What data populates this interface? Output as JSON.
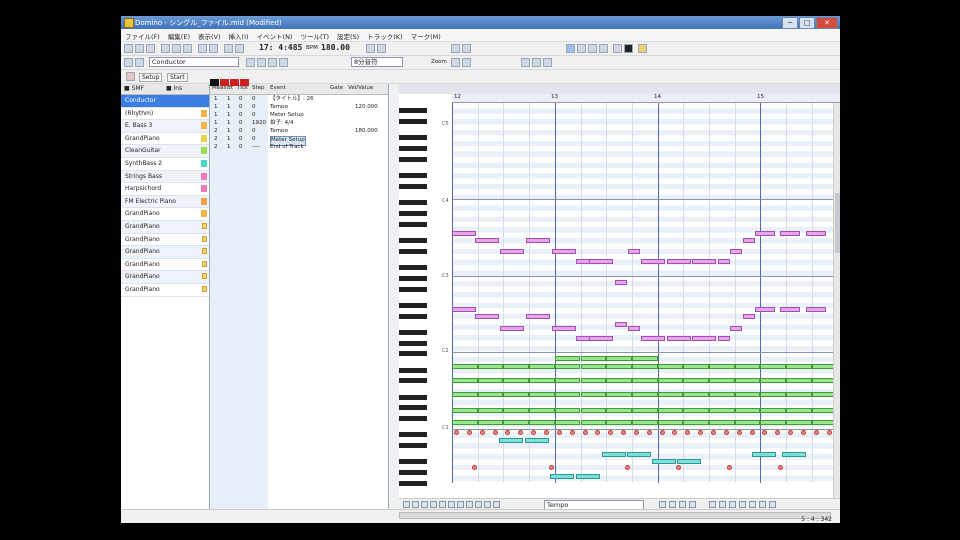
{
  "window": {
    "title": "Domino - シングル_ファイル.mid (Modified)",
    "controls": [
      "─",
      "□",
      "✕"
    ]
  },
  "menu": [
    "ファイル(F)",
    "編集(E)",
    "表示(V)",
    "挿入(I)",
    "イベント(N)",
    "ツール(T)",
    "設定(S)",
    "トラック(K)",
    "マーク(M)"
  ],
  "toolbar": {
    "position": "17: 4:485",
    "tempo_label": "BPM",
    "tempo": "180.00",
    "track_combo": "Conductor",
    "zoom_label": "Zoom",
    "snap_combo": "8分音符",
    "sub_buttons": [
      "Setup",
      "Start"
    ]
  },
  "track_panel": {
    "header_left": "■ SMF",
    "header_right": "■ Ins",
    "tracks": [
      {
        "name": "Conductor",
        "selected": true,
        "color": "#3b7de0",
        "marker": "none"
      },
      {
        "name": "(Rhythm)",
        "color": "#f2b448",
        "marker": "dot"
      },
      {
        "name": "E. Bass 3",
        "color": "#f2b448",
        "marker": "dot"
      },
      {
        "name": "GrandPiano",
        "color": "#e8d44a",
        "marker": "dot"
      },
      {
        "name": "CleanGuitar",
        "color": "#9ade50",
        "marker": "dot"
      },
      {
        "name": "SynthBass 2",
        "color": "#48d8c8",
        "marker": "dot"
      },
      {
        "name": "Strings Bass",
        "color": "#f07ab8",
        "marker": "dot"
      },
      {
        "name": "Harpsichord",
        "color": "#f07ab8",
        "marker": "dot"
      },
      {
        "name": "FM Electric Piano",
        "color": "#f2a048",
        "marker": "dot"
      },
      {
        "name": "GrandPiano",
        "color": "#f2b448",
        "marker": "dot"
      },
      {
        "name": "GrandPiano",
        "color": "#f2b448",
        "marker": "lock"
      },
      {
        "name": "GrandPiano",
        "color": "#f2b448",
        "marker": "lock"
      },
      {
        "name": "GrandPiano",
        "color": "#f2b448",
        "marker": "lock"
      },
      {
        "name": "GrandPiano",
        "color": "#f2b448",
        "marker": "lock"
      },
      {
        "name": "GrandPiano",
        "color": "#f2b448",
        "marker": "lock"
      },
      {
        "name": "GrandPiano",
        "color": "#f2b448",
        "marker": "lock"
      }
    ]
  },
  "event_list": {
    "columns": [
      "Meas",
      "Bt",
      "Tick",
      "Step",
      "Event",
      "Gate",
      "Vel/Value"
    ],
    "rows": [
      {
        "meas": "1",
        "bt": "1",
        "tick": "0",
        "step": "0",
        "event": "【タイトル】: 26",
        "gate": "",
        "value": ""
      },
      {
        "meas": "1",
        "bt": "1",
        "tick": "0",
        "step": "0",
        "event": "Tempo",
        "gate": "",
        "value": "120.000"
      },
      {
        "meas": "1",
        "bt": "1",
        "tick": "0",
        "step": "0",
        "event": "Meter Setup",
        "gate": "",
        "value": ""
      },
      {
        "meas": "1",
        "bt": "1",
        "tick": "0",
        "step": "1920",
        "event": "拍子: 4/4",
        "gate": "",
        "value": ""
      },
      {
        "meas": "2",
        "bt": "1",
        "tick": "0",
        "step": "0",
        "event": "Tempo",
        "gate": "",
        "value": "180.000"
      },
      {
        "meas": "2",
        "bt": "1",
        "tick": "0",
        "step": "0",
        "event": "Meter Setup",
        "gate": "",
        "value": "",
        "selected": true
      },
      {
        "meas": "2",
        "bt": "1",
        "tick": "0",
        "step": "----",
        "event": "End of Track",
        "gate": "",
        "value": ""
      }
    ]
  },
  "piano_roll": {
    "measure_labels": [
      "12",
      "13",
      "14",
      "15"
    ],
    "octave_labels": [
      "C5",
      "C4",
      "C3",
      "C2",
      "C1"
    ]
  },
  "drawbar": {
    "combo": "Tempo"
  },
  "status": {
    "position": "5 : 4 : 342"
  },
  "colors": {
    "titlebar": "#3f72b8",
    "note_pink": "#e8a4e8",
    "note_green": "#99e48c",
    "note_cyan": "#7ee0d8",
    "drum_hit": "#f08a8a",
    "measure_line": "#5566aa"
  }
}
